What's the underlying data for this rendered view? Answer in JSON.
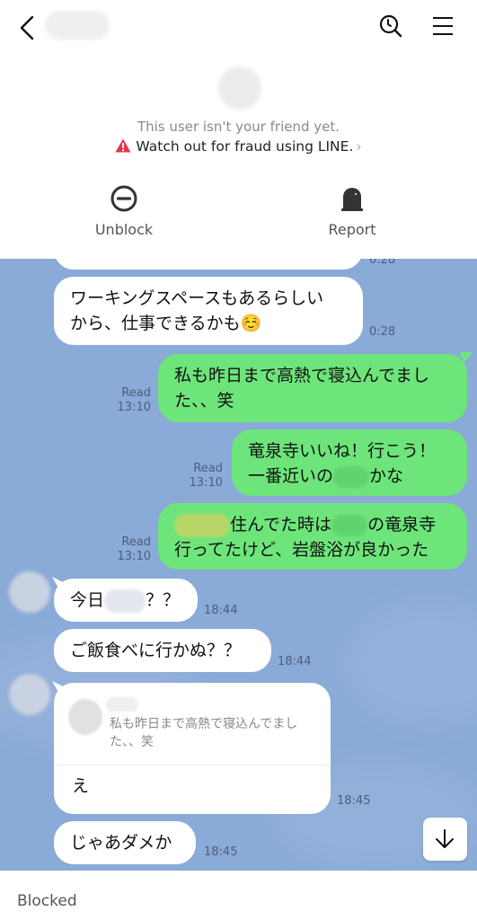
{
  "header": {
    "back_icon": "chevron-left-icon",
    "chat_name": "",
    "search_icon": "search-history-icon",
    "menu_icon": "hamburger-menu-icon"
  },
  "profile": {
    "not_friend_text": "This user isn't your friend yet.",
    "fraud_warning_text": "Watch out for fraud using LINE.",
    "fraud_icon": "warning-triangle-icon",
    "warning_color": "#e8334a"
  },
  "actions": [
    {
      "label": "Unblock",
      "icon": "minus-circle-icon"
    },
    {
      "label": "Report",
      "icon": "siren-icon"
    }
  ],
  "colors": {
    "chat_background": "#8aaad8",
    "outgoing_bubble": "#6de57a",
    "incoming_bubble": "#ffffff"
  },
  "messages": [
    {
      "direction": "in",
      "text": "",
      "time": "0:28",
      "partial": true
    },
    {
      "direction": "in",
      "lines": [
        "ワーキングスペースもあるらしい",
        "から、仕事できるかも"
      ],
      "emoji": "☺️",
      "time": "0:28"
    },
    {
      "direction": "out",
      "lines": [
        "私も昨日まで高熱で寝込んでまし",
        "た、、笑"
      ],
      "read": "Read",
      "time": "13:10"
    },
    {
      "direction": "out",
      "lines": [
        "竜泉寺いいね！行こう！",
        "一番近いの",
        "かな"
      ],
      "read": "Read",
      "time": "13:10"
    },
    {
      "direction": "out",
      "lines": [
        "住んでた時は",
        "の竜泉寺",
        "行ってたけど、岩盤浴が良かった"
      ],
      "read": "Read",
      "time": "13:10"
    },
    {
      "direction": "in",
      "lines": [
        "今日",
        "？？"
      ],
      "time": "18:44"
    },
    {
      "direction": "in",
      "lines": [
        "ご飯食べに行かぬ？？"
      ],
      "time": "18:44"
    },
    {
      "direction": "in",
      "reply_to": {
        "text_lines": [
          "私も昨日まで高熱で寝込んでまし",
          "た、、笑"
        ]
      },
      "lines": [
        "え"
      ],
      "time": "18:45"
    },
    {
      "direction": "in",
      "lines": [
        "じゃあダメか"
      ],
      "time": "18:45"
    }
  ],
  "scroll_down_icon": "arrow-down-icon",
  "footer": {
    "status_text": "Blocked"
  }
}
